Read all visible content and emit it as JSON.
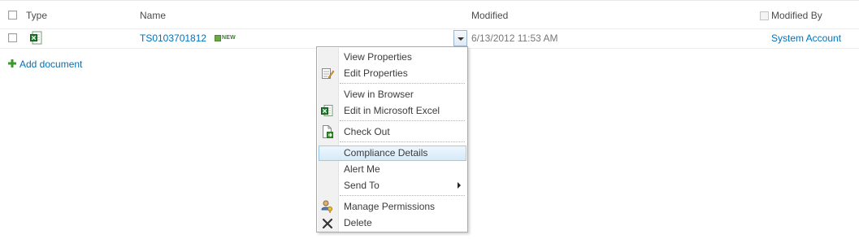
{
  "header": {
    "type": "Type",
    "name": "Name",
    "modified": "Modified",
    "modified_by": "Modified By"
  },
  "row": {
    "name": "TS0103701812",
    "new_badge": "NEW",
    "modified": "6/13/2012 11:53 AM",
    "modified_by": "System Account"
  },
  "add_document": "Add document",
  "menu": {
    "items": [
      {
        "label": "View Properties",
        "icon": "none"
      },
      {
        "label": "Edit Properties",
        "icon": "edit-properties-icon"
      },
      {
        "label": "View in Browser",
        "icon": "none"
      },
      {
        "label": "Edit in Microsoft Excel",
        "icon": "excel-icon"
      },
      {
        "label": "Check Out",
        "icon": "check-out-icon"
      },
      {
        "label": "Compliance Details",
        "icon": "none",
        "highlighted": true
      },
      {
        "label": "Alert Me",
        "icon": "none"
      },
      {
        "label": "Send To",
        "icon": "none",
        "has_submenu": true
      },
      {
        "label": "Manage Permissions",
        "icon": "permissions-icon"
      },
      {
        "label": "Delete",
        "icon": "delete-icon"
      }
    ]
  },
  "colors": {
    "link": "#0072bc",
    "highlight": "#d6eaf9",
    "add_icon": "#3a9a2a"
  }
}
